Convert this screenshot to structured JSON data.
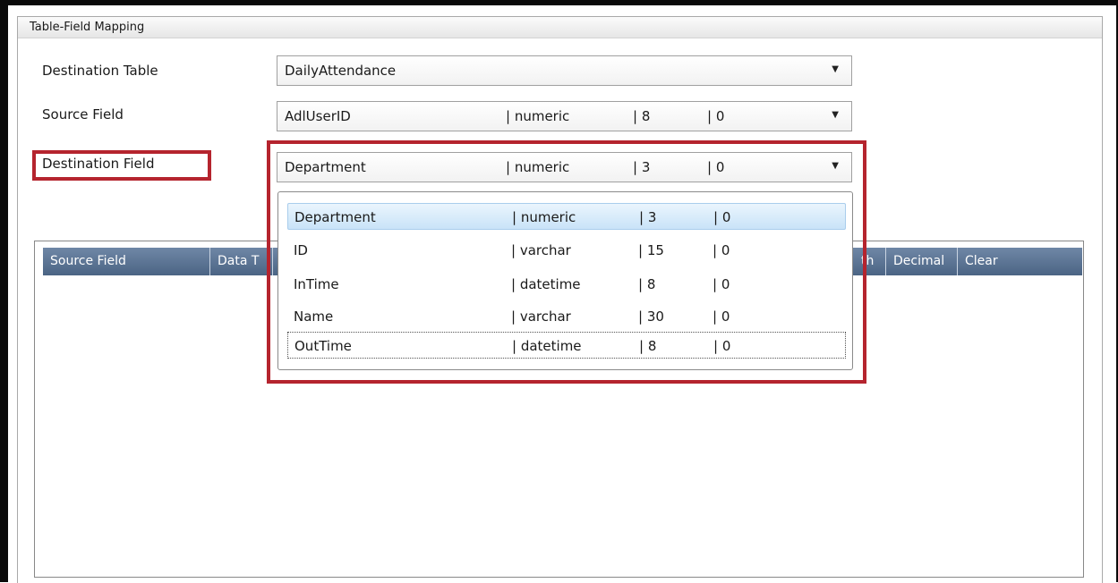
{
  "group": {
    "title": "Table-Field Mapping"
  },
  "labels": {
    "destination_table": "Destination Table",
    "source_field": "Source Field",
    "destination_field": "Destination Field"
  },
  "destination_table": {
    "value": "DailyAttendance"
  },
  "source_field": {
    "name": "AdlUserID",
    "type": "| numeric",
    "length": "| 8",
    "decimal": "| 0"
  },
  "destination_field": {
    "name": "Department",
    "type": "| numeric",
    "length": "| 3",
    "decimal": "| 0"
  },
  "dropdown_options": [
    {
      "name": "Department",
      "type": "| numeric",
      "length": "| 3",
      "decimal": "| 0"
    },
    {
      "name": "ID",
      "type": "| varchar",
      "length": "| 15",
      "decimal": "| 0"
    },
    {
      "name": "InTime",
      "type": "| datetime",
      "length": "| 8",
      "decimal": "| 0"
    },
    {
      "name": "Name",
      "type": "| varchar",
      "length": "| 30",
      "decimal": "| 0"
    },
    {
      "name": "OutTime",
      "type": "| datetime",
      "length": "| 8",
      "decimal": "| 0"
    }
  ],
  "grid": {
    "columns": [
      "Source Field",
      "Data T",
      "th",
      "Decimal",
      "Clear"
    ]
  },
  "colors": {
    "highlight": "#b5242e",
    "grid_header": "#5a7393",
    "selected_item": "#c9e3f8"
  },
  "icons": {
    "combo_arrow": "dropdown-arrow-icon"
  }
}
